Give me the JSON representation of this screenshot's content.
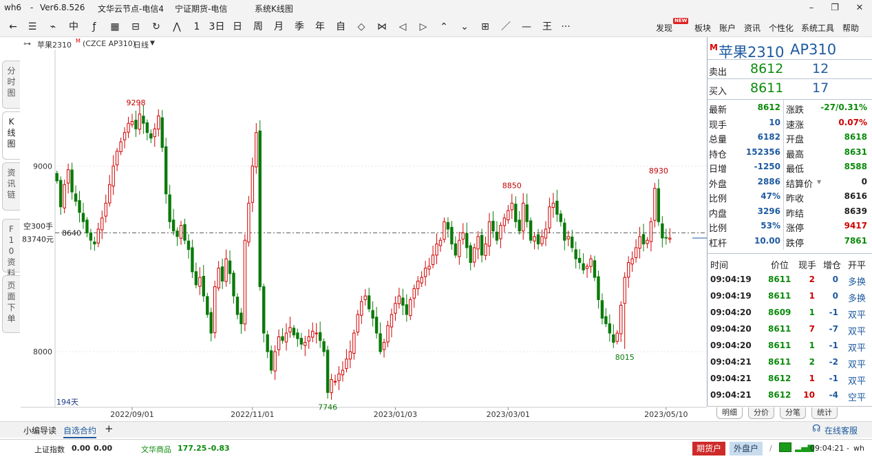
{
  "window": {
    "app": "wh6",
    "dash": "-",
    "version": "Ver6.8.526",
    "server": "文华云节点-电信4",
    "broker": "宁证期货-电信",
    "view": "系统K线图",
    "controls": [
      "–",
      "❐",
      "✕"
    ]
  },
  "toolbar": {
    "icons": [
      "←",
      "☰",
      "⌁",
      "中",
      "ƒ",
      "▦",
      "⊟",
      "↻",
      "⋀",
      "1",
      "3日",
      "日",
      "周",
      "月",
      "季",
      "年",
      "自",
      "◇",
      "⋈",
      "◁",
      "▷",
      "⌃",
      "⌄",
      "⊞",
      "／",
      "—",
      "王",
      "···"
    ],
    "menus": [
      "发现",
      "板块",
      "账户",
      "资讯",
      "个性化",
      "系统工具",
      "帮助"
    ],
    "new_badge": "NEW"
  },
  "left_tabs": [
    "分时图",
    "K线图",
    "资讯链",
    "F10资料",
    "页面下单"
  ],
  "chart_header": {
    "symbol": "苹果2310",
    "symbol_mark": "M",
    "exchange": "(CZCE AP310)",
    "period": "日线"
  },
  "chart_data": {
    "type": "candlestick",
    "y_ticks": [
      9000,
      8000
    ],
    "ylim": [
      7700,
      9620
    ],
    "x_ticks": [
      {
        "label": "2022/09/01",
        "index": 20
      },
      {
        "label": "2022/11/01",
        "index": 52
      },
      {
        "label": "2023/01/03",
        "index": 90
      },
      {
        "label": "2023/03/01",
        "index": 120
      },
      {
        "label": "2023/05/10",
        "index": 162
      }
    ],
    "reference_line": 8640,
    "reference_line_label": "8640",
    "crosshair_label_1": "空300手",
    "crosshair_label_2": "83740元",
    "bar_count_label": "194天",
    "annotations": [
      {
        "text": "9298",
        "index": 21,
        "value": 9298,
        "kind": "high"
      },
      {
        "text": "7746",
        "index": 72,
        "value": 7746,
        "kind": "low"
      },
      {
        "text": "8850",
        "index": 121,
        "value": 8850,
        "kind": "high"
      },
      {
        "text": "8015",
        "index": 151,
        "value": 8015,
        "kind": "low"
      },
      {
        "text": "8930",
        "index": 160,
        "value": 8930,
        "kind": "high"
      }
    ],
    "closes": [
      8920,
      8780,
      8900,
      8980,
      8860,
      8810,
      8750,
      8700,
      8640,
      8600,
      8580,
      8660,
      8720,
      8800,
      8900,
      9000,
      9080,
      9130,
      9180,
      9230,
      9240,
      9200,
      9280,
      9230,
      9180,
      9150,
      9200,
      9270,
      9100,
      8850,
      8700,
      8650,
      8620,
      8680,
      8600,
      8550,
      8430,
      8360,
      8400,
      8300,
      8200,
      8100,
      8350,
      8450,
      8380,
      8500,
      8420,
      8300,
      8200,
      8150,
      8600,
      8800,
      9000,
      9180,
      8350,
      8100,
      8000,
      7900,
      8000,
      8080,
      8060,
      8100,
      8130,
      8090,
      8070,
      8040,
      8050,
      8080,
      8110,
      8100,
      8060,
      8000,
      7780,
      7850,
      7840,
      7880,
      7900,
      7960,
      8000,
      8100,
      8200,
      8270,
      8300,
      8230,
      8180,
      8100,
      8000,
      8050,
      8140,
      8200,
      8260,
      8300,
      8250,
      8200,
      8280,
      8340,
      8380,
      8400,
      8450,
      8460,
      8520,
      8580,
      8600,
      8700,
      8660,
      8580,
      8520,
      8600,
      8640,
      8560,
      8480,
      8560,
      8620,
      8520,
      8580,
      8700,
      8650,
      8600,
      8680,
      8720,
      8760,
      8800,
      8700,
      8650,
      8800,
      8700,
      8600,
      8620,
      8580,
      8620,
      8660,
      8780,
      8800,
      8740,
      8700,
      8600,
      8620,
      8560,
      8500,
      8480,
      8440,
      8460,
      8500,
      8400,
      8280,
      8180,
      8150,
      8100,
      8050,
      8100,
      8250,
      8400,
      8480,
      8500,
      8560,
      8620,
      8580,
      8600,
      8700,
      8880,
      8700,
      8612,
      8612,
      8612
    ]
  },
  "quote": {
    "mark": "M",
    "title": "苹果2310",
    "code": "AP310",
    "ask_label": "卖出",
    "ask_price": "8612",
    "ask_vol": "12",
    "bid_label": "买入",
    "bid_price": "8611",
    "bid_vol": "17",
    "stats": [
      {
        "a": "最新",
        "av": "8612",
        "ac": "#0a8a0a",
        "b": "涨跌",
        "bv": "-27/0.31%",
        "bc": "#0a8a0a"
      },
      {
        "a": "现手",
        "av": "10",
        "ac": "#1e5aa0",
        "b": "速涨",
        "bv": "0.07%",
        "bc": "#d00000"
      },
      {
        "a": "总量",
        "av": "6182",
        "ac": "#1e5aa0",
        "b": "开盘",
        "bv": "8618",
        "bc": "#0a8a0a"
      },
      {
        "a": "持仓",
        "av": "152356",
        "ac": "#1e5aa0",
        "b": "最高",
        "bv": "8631",
        "bc": "#0a8a0a"
      },
      {
        "a": "日增",
        "av": "-1250",
        "ac": "#1e5aa0",
        "b": "最低",
        "bv": "8588",
        "bc": "#0a8a0a"
      },
      {
        "a": "外盘",
        "av": "2886",
        "ac": "#1e5aa0",
        "b": "结算价",
        "bv": "0",
        "bc": "#222222"
      },
      {
        "a": "比例",
        "av": "47%",
        "ac": "#1e5aa0",
        "b": "昨收",
        "bv": "8616",
        "bc": "#222222"
      },
      {
        "a": "内盘",
        "av": "3296",
        "ac": "#1e5aa0",
        "b": "昨结",
        "bv": "8639",
        "bc": "#222222"
      },
      {
        "a": "比例",
        "av": "53%",
        "ac": "#1e5aa0",
        "b": "涨停",
        "bv": "9417",
        "bc": "#d00000"
      },
      {
        "a": "杠杆",
        "av": "10.00",
        "ac": "#1e5aa0",
        "b": "跌停",
        "bv": "7861",
        "bc": "#0a8a0a"
      }
    ],
    "trade_headers": [
      "时间",
      "价位",
      "现手",
      "增仓",
      "开平"
    ],
    "trades": [
      {
        "time": "09:04:19",
        "price": "8611",
        "vol": "2",
        "oi": "0",
        "type": "多换",
        "vc": "#d00000"
      },
      {
        "time": "09:04:19",
        "price": "8611",
        "vol": "1",
        "oi": "0",
        "type": "多换",
        "vc": "#d00000"
      },
      {
        "time": "09:04:20",
        "price": "8609",
        "vol": "1",
        "oi": "-1",
        "type": "双平",
        "vc": "#0a8a0a"
      },
      {
        "time": "09:04:20",
        "price": "8611",
        "vol": "7",
        "oi": "-7",
        "type": "双平",
        "vc": "#d00000"
      },
      {
        "time": "09:04:20",
        "price": "8611",
        "vol": "1",
        "oi": "-1",
        "type": "双平",
        "vc": "#0a8a0a"
      },
      {
        "time": "09:04:21",
        "price": "8611",
        "vol": "2",
        "oi": "-2",
        "type": "双平",
        "vc": "#0a8a0a"
      },
      {
        "time": "09:04:21",
        "price": "8612",
        "vol": "1",
        "oi": "-1",
        "type": "双平",
        "vc": "#d00000"
      },
      {
        "time": "09:04:21",
        "price": "8612",
        "vol": "10",
        "oi": "-4",
        "type": "空平",
        "vc": "#d00000"
      }
    ],
    "tabs": [
      "明细",
      "分价",
      "分笔",
      "统计"
    ]
  },
  "bottom": {
    "tab1": "小编导读",
    "tab2": "自选合约",
    "add": "+",
    "service": "在线客服"
  },
  "status": {
    "index1_name": "上证指数",
    "index1_val": "0.00",
    "index1_chg": "0.00",
    "index2_name": "文华商品",
    "index2_val": "177.25",
    "index2_chg": "-0.83",
    "btn_futures": "期货户",
    "btn_foreign": "外盘户",
    "time": "09:04:21",
    "dash": "-",
    "user": "wh"
  },
  "colors": {
    "up": "#d00000",
    "down": "#0a7a0a",
    "accent": "#1e5aa0"
  }
}
